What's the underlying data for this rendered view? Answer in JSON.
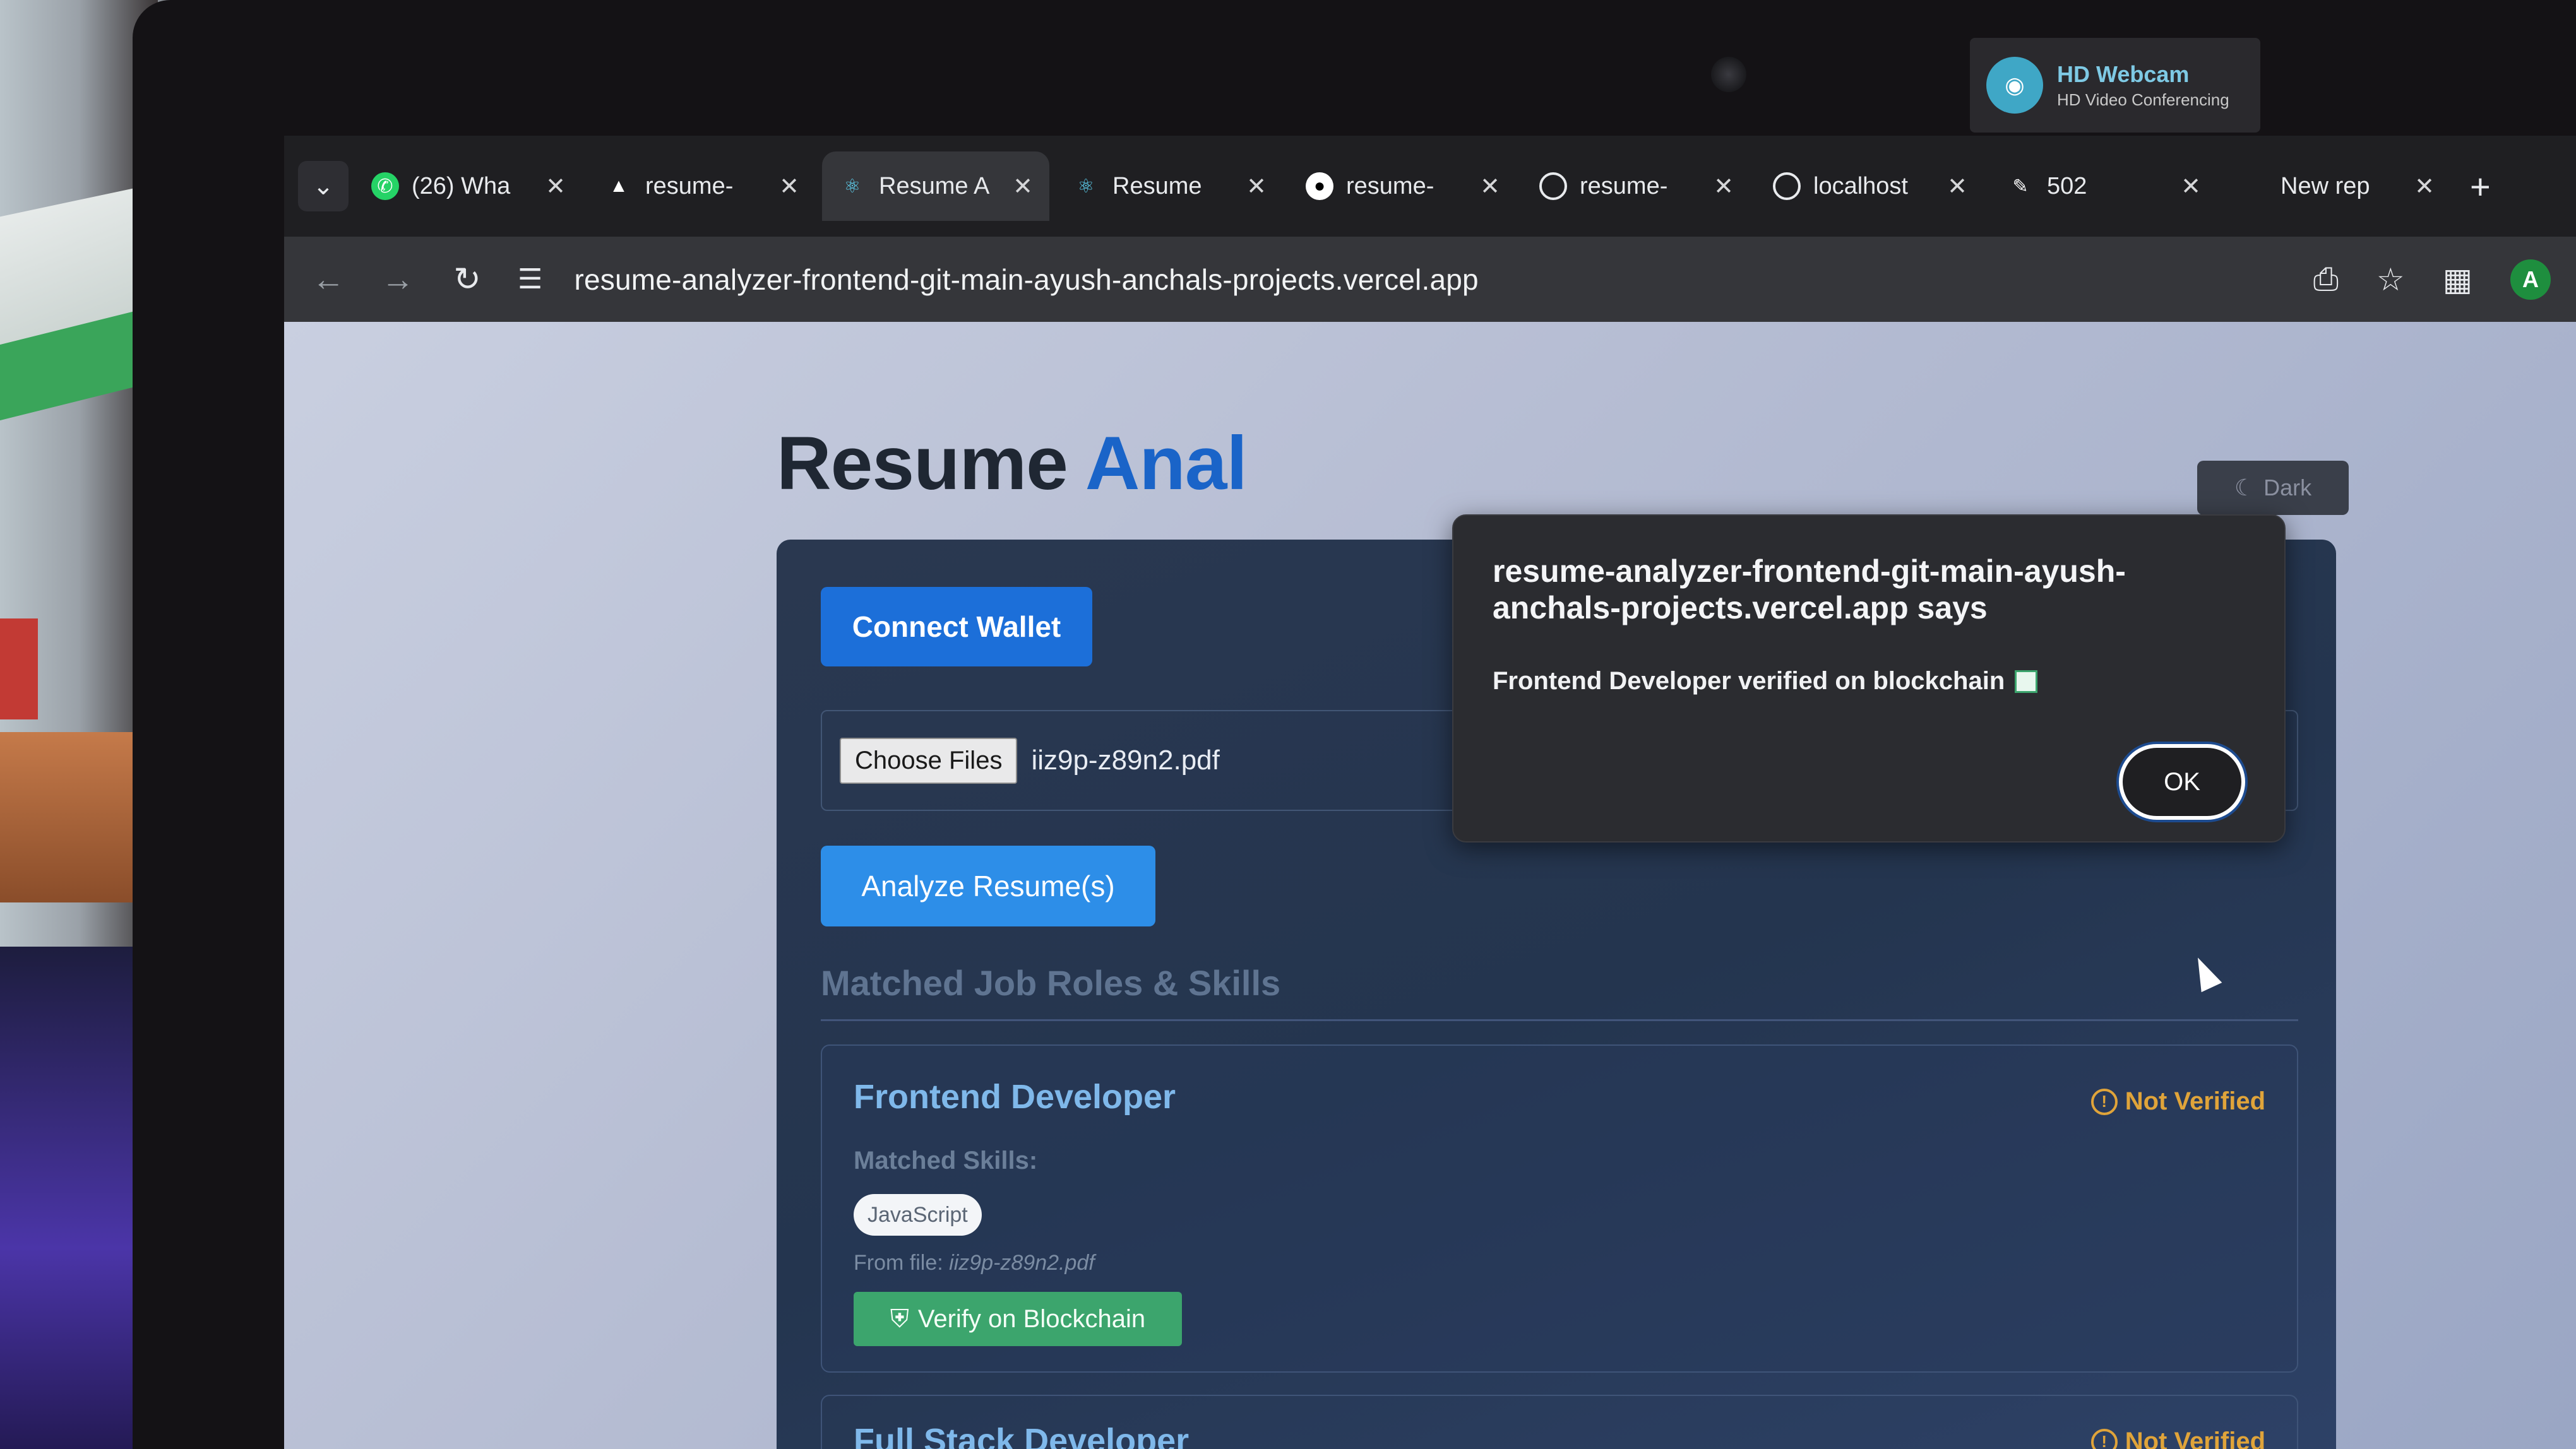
{
  "webcam": {
    "title": "HD Webcam",
    "subtitle": "HD Video Conferencing"
  },
  "tabs": [
    {
      "label": "(26) Wha",
      "icon": "whatsapp-icon"
    },
    {
      "label": "resume-",
      "icon": "triangle-icon"
    },
    {
      "label": "Resume A",
      "icon": "react-icon",
      "active": true
    },
    {
      "label": "Resume",
      "icon": "react-icon"
    },
    {
      "label": "resume-",
      "icon": "github-icon"
    },
    {
      "label": "resume-",
      "icon": "globe-icon"
    },
    {
      "label": "localhost",
      "icon": "globe-icon"
    },
    {
      "label": "502",
      "icon": "page-icon"
    },
    {
      "label": "New rep",
      "icon": "blank-icon"
    }
  ],
  "address_bar": {
    "url": "resume-analyzer-frontend-git-main-ayush-anchals-projects.vercel.app"
  },
  "profile": {
    "initial": "A"
  },
  "page": {
    "title_part1": "Resume",
    "title_part2": "Anal",
    "dark_toggle": "Dark",
    "connect_wallet": "Connect Wallet",
    "choose_files": "Choose Files",
    "file_name": "iiz9p-z89n2.pdf",
    "analyze_button": "Analyze Resume(s)",
    "section_title": "Matched Job Roles & Skills",
    "roles": [
      {
        "title": "Frontend Developer",
        "status": "Not Verified",
        "matched_label": "Matched Skills:",
        "skills": [
          "JavaScript"
        ],
        "from_file_prefix": "From file:",
        "from_file": "iiz9p-z89n2.pdf",
        "verify_button": "Verify on Blockchain"
      },
      {
        "title": "Full Stack Developer",
        "status": "Not Verified"
      }
    ]
  },
  "dialog": {
    "title": "resume-analyzer-frontend-git-main-ayush-anchals-projects.vercel.app says",
    "message": "Frontend Developer verified on blockchain",
    "ok": "OK"
  },
  "colors": {
    "accent": "#1a64c8",
    "connect": "#1c6fd9",
    "analyze": "#2d8ee8",
    "verify": "#3ca56d",
    "not_verified": "#e0a43a"
  }
}
